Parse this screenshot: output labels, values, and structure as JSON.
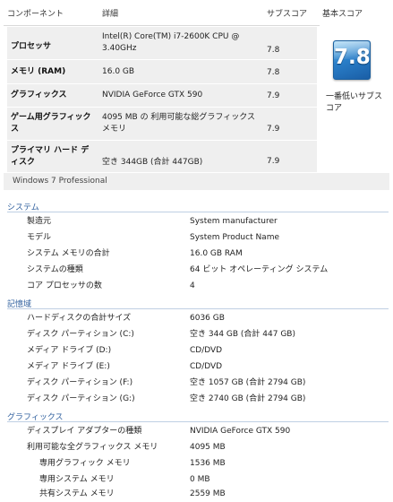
{
  "score_table": {
    "headers": {
      "component": "コンポーネント",
      "details": "詳細",
      "subscore": "サブスコア",
      "base_score": "基本スコア"
    },
    "rows": [
      {
        "label": "プロセッサ",
        "details": "Intel(R) Core(TM) i7-2600K CPU @ 3.40GHz",
        "subscore": "7.8"
      },
      {
        "label": "メモリ (RAM)",
        "details": "16.0 GB",
        "subscore": "7.8"
      },
      {
        "label": "グラフィックス",
        "details": "NVIDIA GeForce GTX 590",
        "subscore": "7.9"
      },
      {
        "label": "ゲーム用グラフィックス",
        "details": "4095 MB の 利用可能な総グラフィックス メモリ",
        "subscore": "7.9"
      },
      {
        "label": "プライマリ ハード ディスク",
        "details": "空き 344GB (合計 447GB)",
        "subscore": "7.9"
      }
    ],
    "base_score": {
      "value": "7.8",
      "caption": "一番低いサブスコア"
    },
    "os": "Windows 7 Professional"
  },
  "sections": [
    {
      "title": "システム",
      "rows": [
        {
          "label": "製造元",
          "value": "System manufacturer"
        },
        {
          "label": "モデル",
          "value": "System Product Name"
        },
        {
          "label": "システム メモリの合計",
          "value": "16.0 GB RAM"
        },
        {
          "label": "システムの種類",
          "value": "64 ビット オペレーティング システム"
        },
        {
          "label": "コア プロセッサの数",
          "value": "4"
        }
      ]
    },
    {
      "title": "記憶域",
      "rows": [
        {
          "label": "ハードディスクの合計サイズ",
          "value": "6036 GB"
        },
        {
          "label": "ディスク パーティション (C:)",
          "value": "空き 344 GB (合計 447 GB)"
        },
        {
          "label": "メディア ドライブ (D:)",
          "value": "CD/DVD"
        },
        {
          "label": "メディア ドライブ (E:)",
          "value": "CD/DVD"
        },
        {
          "label": "ディスク パーティション (F:)",
          "value": "空き 1057 GB (合計 2794 GB)"
        },
        {
          "label": "ディスク パーティション (G:)",
          "value": "空き 2740 GB (合計 2794 GB)"
        }
      ]
    },
    {
      "title": "グラフィックス",
      "rows": [
        {
          "label": "ディスプレイ アダプターの種類",
          "value": "NVIDIA GeForce GTX 590"
        },
        {
          "label": "利用可能な全グラフィックス メモリ",
          "value": "4095 MB"
        },
        {
          "label": "専用グラフィック メモリ",
          "value": "1536 MB"
        },
        {
          "label": "専用システム メモリ",
          "value": "0 MB"
        },
        {
          "label": "共有システム メモリ",
          "value": "2559 MB"
        }
      ]
    }
  ],
  "colors": {
    "section_title": "#2f5f9e",
    "row_bg": "#efefef",
    "badge": "#2a7fc9"
  }
}
